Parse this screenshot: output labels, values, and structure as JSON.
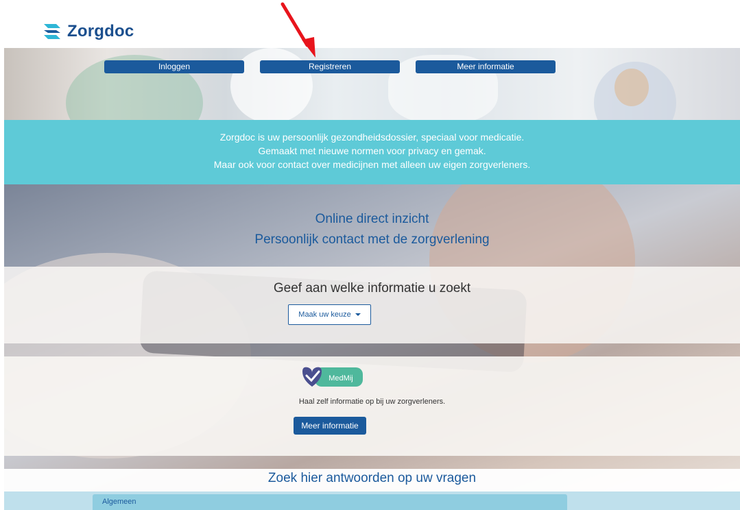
{
  "brand": {
    "name": "Zorgdoc",
    "primary_color": "#1b5a9c",
    "accent_color": "#50c6d4"
  },
  "nav": [
    {
      "label": "Inloggen"
    },
    {
      "label": "Registreren"
    },
    {
      "label": "Meer informatie"
    }
  ],
  "banner": {
    "line1": "Zorgdoc is uw persoonlijk gezondheidsdossier, speciaal voor medicatie.",
    "line2": "Gemaakt met nieuwe normen voor privacy en gemak.",
    "line3": "Maar ook voor contact over medicijnen met alleen uw eigen zorgverleners."
  },
  "tagline": {
    "line1": "Online direct inzicht",
    "line2": "Persoonlijk contact met de zorgverlening"
  },
  "choice": {
    "title": "Geef aan welke informatie u zoekt",
    "dropdown_label": "Maak uw keuze"
  },
  "medmij": {
    "logo_text": "MedMij",
    "description": "Haal zelf informatie op bij uw zorgverleners.",
    "button_label": "Meer informatie"
  },
  "faq": {
    "title": "Zoek hier antwoorden op uw vragen",
    "items": [
      {
        "label": "Algemeen"
      }
    ]
  },
  "annotation": {
    "arrow_color": "#e8141c",
    "icon": "red-arrow-icon"
  }
}
